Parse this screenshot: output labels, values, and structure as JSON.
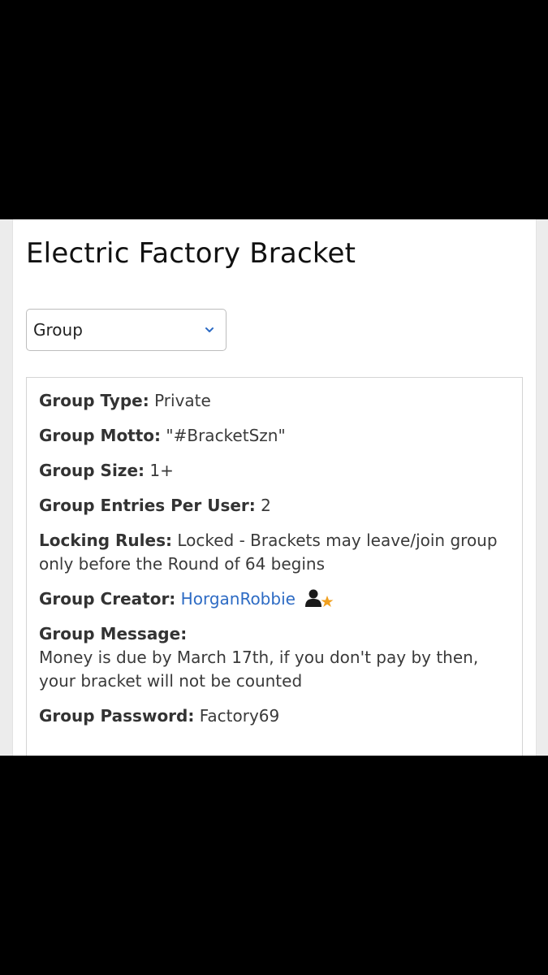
{
  "page": {
    "title": "Electric Factory Bracket"
  },
  "selector": {
    "selected_value": "Group"
  },
  "group_info": {
    "type": {
      "label": "Group Type:",
      "value": "Private"
    },
    "motto": {
      "label": "Group Motto:",
      "value": "\"#BracketSzn\""
    },
    "size": {
      "label": "Group Size:",
      "value": "1+"
    },
    "entries": {
      "label": "Group Entries Per User:",
      "value": "2"
    },
    "locking": {
      "label": "Locking Rules:",
      "value": "Locked - Brackets may leave/join group only before the Round of 64 begins"
    },
    "creator": {
      "label": "Group Creator:",
      "value": "HorganRobbie",
      "icon": "user-star-icon"
    },
    "message": {
      "label": "Group Message:",
      "value": "Money is due by March 17th, if you don't pay by then, your bracket will not be counted"
    },
    "password": {
      "label": "Group Password:",
      "value": "Factory69"
    }
  },
  "colors": {
    "link": "#2d6bc4",
    "star": "#f0a020",
    "chevron": "#2d6bc4"
  }
}
